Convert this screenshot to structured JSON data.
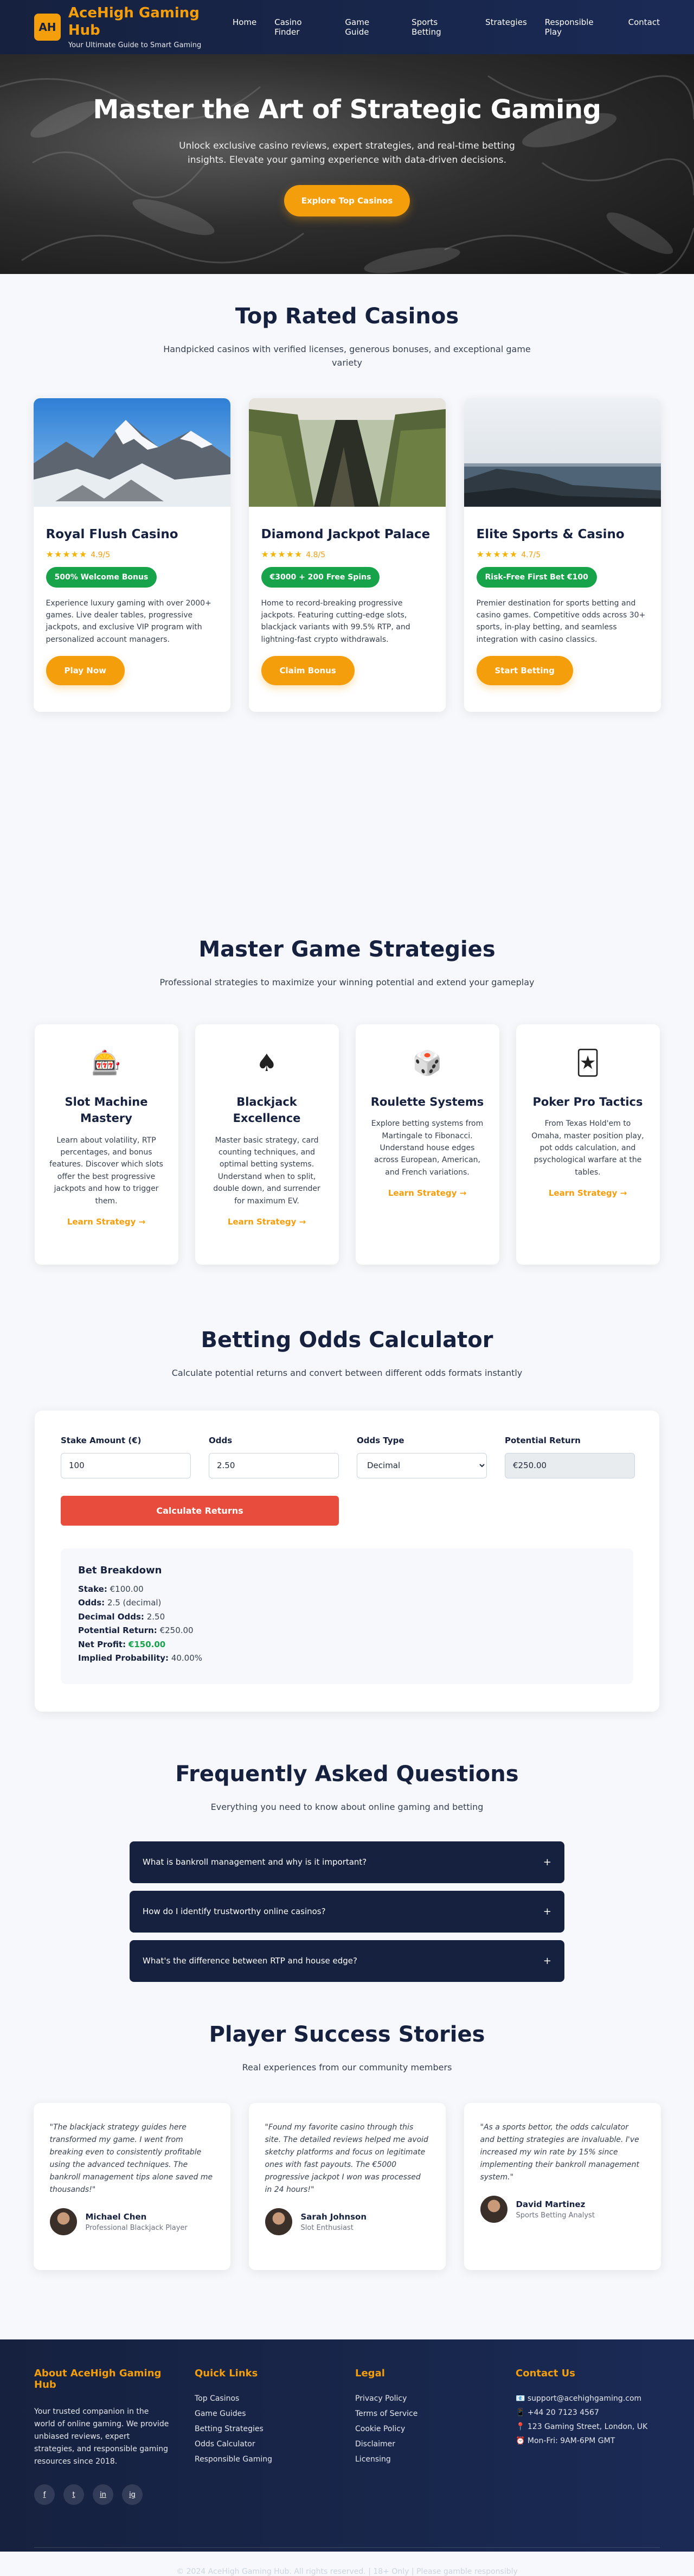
{
  "header": {
    "logo_text": "AH",
    "title": "AceHigh Gaming Hub",
    "subtitle": "Your Ultimate Guide to Smart Gaming",
    "nav": [
      "Home",
      "Casino Finder",
      "Game Guide",
      "Sports Betting",
      "Strategies",
      "Responsible Play",
      "Contact"
    ]
  },
  "hero": {
    "title": "Master the Art of Strategic Gaming",
    "text": "Unlock exclusive casino reviews, expert strategies, and real-time betting insights. Elevate your gaming experience with data-driven decisions.",
    "cta": "Explore Top Casinos"
  },
  "casinos": {
    "title": "Top Rated Casinos",
    "lead": "Handpicked casinos with verified licenses, generous bonuses, and exceptional game variety",
    "items": [
      {
        "name": "Royal Flush Casino",
        "stars": "★★★★★",
        "rating": "4.9/5",
        "bonus": "500% Welcome Bonus",
        "desc": "Experience luxury gaming with over 2000+ games. Live dealer tables, progressive jackpots, and exclusive VIP program with personalized account managers.",
        "cta": "Play Now"
      },
      {
        "name": "Diamond Jackpot Palace",
        "stars": "★★★★★",
        "rating": "4.8/5",
        "bonus": "€3000 + 200 Free Spins",
        "desc": "Home to record-breaking progressive jackpots. Featuring cutting-edge slots, blackjack variants with 99.5% RTP, and lightning-fast crypto withdrawals.",
        "cta": "Claim Bonus"
      },
      {
        "name": "Elite Sports & Casino",
        "stars": "★★★★★",
        "rating": "4.7/5",
        "bonus": "Risk-Free First Bet €100",
        "desc": "Premier destination for sports betting and casino games. Competitive odds across 30+ sports, in-play betting, and seamless integration with casino classics.",
        "cta": "Start Betting"
      }
    ]
  },
  "strategies": {
    "title": "Master Game Strategies",
    "lead": "Professional strategies to maximize your winning potential and extend your gameplay",
    "items": [
      {
        "icon": "🎰",
        "title": "Slot Machine Mastery",
        "desc": "Learn about volatility, RTP percentages, and bonus features. Discover which slots offer the best progressive jackpots and how to trigger them.",
        "link": "Learn Strategy →"
      },
      {
        "icon": "♠",
        "title": "Blackjack Excellence",
        "desc": "Master basic strategy, card counting techniques, and optimal betting systems. Understand when to split, double down, and surrender for maximum EV.",
        "link": "Learn Strategy →"
      },
      {
        "icon": "🎲",
        "title": "Roulette Systems",
        "desc": "Explore betting systems from Martingale to Fibonacci. Understand house edges across European, American, and French variations.",
        "link": "Learn Strategy →"
      },
      {
        "icon": "🃏",
        "title": "Poker Pro Tactics",
        "desc": "From Texas Hold'em to Omaha, master position play, pot odds calculation, and psychological warfare at the tables.",
        "link": "Learn Strategy →"
      }
    ]
  },
  "calculator": {
    "title": "Betting Odds Calculator",
    "lead": "Calculate potential returns and convert between different odds formats instantly",
    "stake_label": "Stake Amount (€)",
    "stake_value": "100",
    "odds_label": "Odds",
    "odds_value": "2.50",
    "type_label": "Odds Type",
    "type_value": "Decimal",
    "return_label": "Potential Return",
    "return_value": "€250.00",
    "button": "Calculate Returns",
    "breakdown_title": "Bet Breakdown",
    "lines": [
      {
        "label": "Stake:",
        "value": "€100.00"
      },
      {
        "label": "Odds:",
        "value": "2.5 (decimal)"
      },
      {
        "label": "Decimal Odds:",
        "value": "2.50"
      },
      {
        "label": "Potential Return:",
        "value": "€250.00"
      },
      {
        "label": "Net Profit:",
        "value": "€150.00"
      },
      {
        "label": "Implied Probability:",
        "value": "40.00%"
      }
    ]
  },
  "faq": {
    "title": "Frequently Asked Questions",
    "lead": "Everything you need to know about online gaming and betting",
    "items": [
      "What is bankroll management and why is it important?",
      "How do I identify trustworthy online casinos?",
      "What's the difference between RTP and house edge?"
    ],
    "toggle": "+"
  },
  "testimonials": {
    "title": "Player Success Stories",
    "lead": "Real experiences from our community members",
    "items": [
      {
        "quote": "\"The blackjack strategy guides here transformed my game. I went from breaking even to consistently profitable using the advanced techniques. The bankroll management tips alone saved me thousands!\"",
        "name": "Michael Chen",
        "role": "Professional Blackjack Player"
      },
      {
        "quote": "\"Found my favorite casino through this site. The detailed reviews helped me avoid sketchy platforms and focus on legitimate ones with fast payouts. The €5000 progressive jackpot I won was processed in 24 hours!\"",
        "name": "Sarah Johnson",
        "role": "Slot Enthusiast"
      },
      {
        "quote": "\"As a sports bettor, the odds calculator and betting strategies are invaluable. I've increased my win rate by 15% since implementing their bankroll management system.\"",
        "name": "David Martinez",
        "role": "Sports Betting Analyst"
      }
    ]
  },
  "footer": {
    "about_title": "About AceHigh Gaming Hub",
    "about_text": "Your trusted companion in the world of online gaming. We provide unbiased reviews, expert strategies, and responsible gaming resources since 2018.",
    "socials": [
      "f",
      "t",
      "in",
      "ig"
    ],
    "links_title": "Quick Links",
    "links": [
      "Top Casinos",
      "Game Guides",
      "Betting Strategies",
      "Odds Calculator",
      "Responsible Gaming"
    ],
    "legal_title": "Legal",
    "legal": [
      "Privacy Policy",
      "Terms of Service",
      "Cookie Policy",
      "Disclaimer",
      "Licensing"
    ],
    "contact_title": "Contact Us",
    "contact": [
      "📧 support@acehighgaming.com",
      "📱 +44 20 7123 4567",
      "📍 123 Gaming Street, London, UK",
      "⏰ Mon-Fri: 9AM-6PM GMT"
    ],
    "copyright": "© 2024 AceHigh Gaming Hub. All rights reserved. | 18+ Only | Please gamble responsibly"
  }
}
